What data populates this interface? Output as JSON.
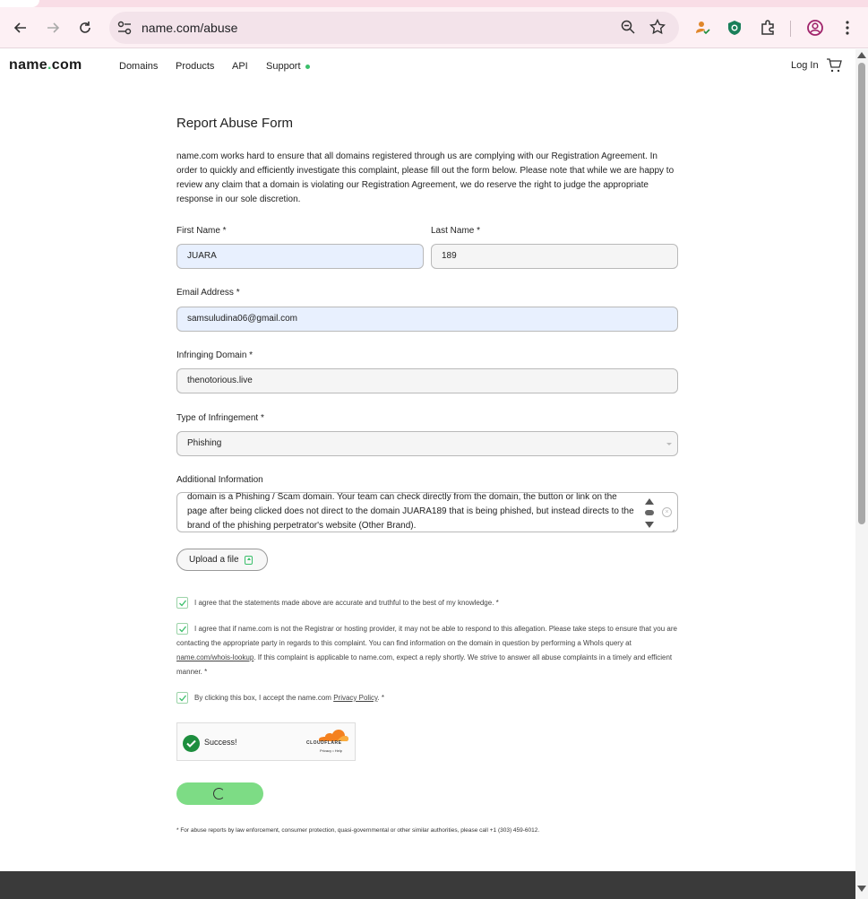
{
  "browser": {
    "url": "name.com/abuse"
  },
  "header": {
    "logo_main": "name",
    "logo_dot": ".",
    "logo_tld": "com",
    "nav": [
      "Domains",
      "Products",
      "API",
      "Support"
    ],
    "login": "Log In"
  },
  "form": {
    "title": "Report Abuse Form",
    "intro": "name.com works hard to ensure that all domains registered through us are complying with our Registration Agreement. In order to quickly and efficiently investigate this complaint, please fill out the form below. Please note that while we are happy to review any claim that a domain is violating our Registration Agreement, we do reserve the right to judge the appropriate response in our sole discretion.",
    "first_name_label": "First Name *",
    "first_name_value": "JUARA",
    "last_name_label": "Last Name *",
    "last_name_value": "189",
    "email_label": "Email Address *",
    "email_value": "samsuludina06@gmail.com",
    "domain_label": "Infringing Domain *",
    "domain_value": "thenotorious.live",
    "type_label": "Type of Infringement *",
    "type_value": "Phishing",
    "info_label": "Additional Information",
    "info_value": "domain is a Phishing / Scam domain. Your team can check directly from the domain, the button or link on the page after being clicked does not direct to the domain JUARA189 that is being phished, but instead directs to the brand of the phishing perpetrator's website (Other Brand).",
    "upload_label": "Upload a file",
    "agree1": "I agree that the statements made above are accurate and truthful to the best of my knowledge. *",
    "agree2_a": "I agree that if name.com is not the Registrar or hosting provider, it may not be able to respond to this allegation. Please take steps to ensure that you are contacting the appropriate party in regards to this complaint. You can find information on the domain in question by performing a WhoIs query at ",
    "agree2_link": "name.com/whois-lookup",
    "agree2_b": ". If this complaint is applicable to name.com, expect a reply shortly. We strive to answer all abuse complaints in a timely and efficient manner. *",
    "agree3_a": "By clicking this box, I accept the name.com ",
    "agree3_link": "Privacy Policy",
    "agree3_b": ". *",
    "captcha_status": "Success!",
    "captcha_brand": "CLOUDFLARE",
    "captcha_links": "Privacy  •  Help",
    "footnote": "* For abuse reports by law enforcement, consumer protection, quasi-governmental or other similar authorities, please call +1 (303) 459-6012."
  },
  "colors": {
    "brand_green": "#3bbf6b",
    "submit_green": "#7ddc85",
    "autofill_blue": "#e8f0fe",
    "footer_dark": "#3a3a3a"
  },
  "icons": [
    "back-icon",
    "forward-icon",
    "reload-icon",
    "site-settings-icon",
    "zoom-icon",
    "star-icon",
    "profile-extension-icon",
    "shield-extension-icon",
    "puzzle-icon",
    "account-icon",
    "more-icon",
    "cart-icon",
    "upload-icon",
    "check-icon",
    "cloudflare-icon"
  ]
}
